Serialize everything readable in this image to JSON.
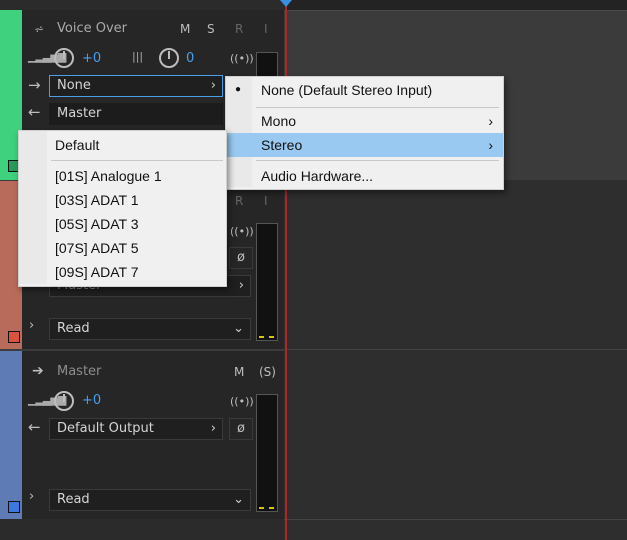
{
  "colors": {
    "track1": "#3fd17d",
    "track2": "#b86b5a",
    "track3": "#5f7bb5",
    "playhead": "#b0242a",
    "selected": "#99c9f0"
  },
  "track1": {
    "name": "Voice Over",
    "m": "M",
    "s": "S",
    "r": "R",
    "i": "I",
    "vol": "+0",
    "pan": "0",
    "input": "None",
    "output": "Master"
  },
  "track2": {
    "r": "R",
    "i": "I",
    "output": "Master",
    "automation": "Read"
  },
  "track3": {
    "name": "Master",
    "m": "M",
    "s": "(S)",
    "vol": "+0",
    "output": "Default Output",
    "automation": "Read"
  },
  "input_menu": {
    "items": [
      "None (Default Stereo Input)",
      "Mono",
      "Stereo",
      "Audio Hardware..."
    ]
  },
  "stereo_menu": {
    "items": [
      "Default",
      "[01S] Analogue 1",
      "[03S] ADAT 1",
      "[05S] ADAT 3",
      "[07S] ADAT 5",
      "[09S] ADAT 7"
    ]
  }
}
